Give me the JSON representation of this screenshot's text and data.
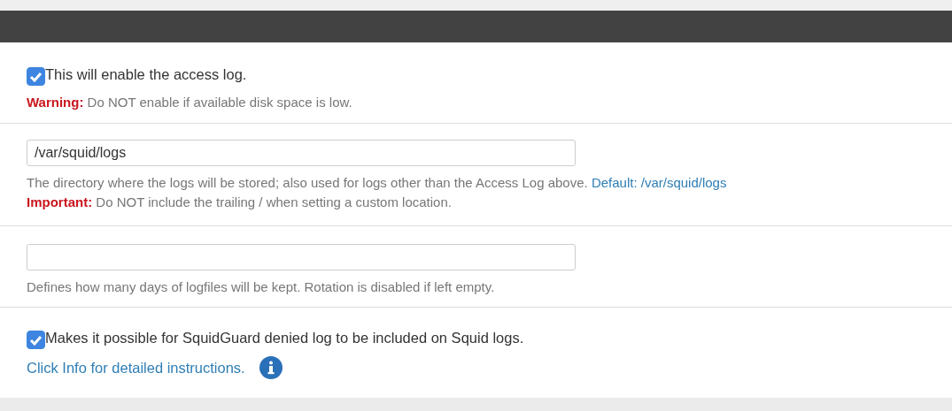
{
  "rows": [
    {
      "kind": "checkbox",
      "checked": true,
      "label": "This will enable the access log.",
      "help": [
        {
          "label": "Warning:",
          "text": "Do NOT enable if available disk space is low."
        }
      ]
    },
    {
      "kind": "input",
      "value": "/var/squid/logs",
      "help": [
        {
          "text": "The directory where the logs will be stored; also used for logs other than the Access Log above.",
          "link": "Default: /var/squid/logs"
        },
        {
          "label": "Important:",
          "text": "Do NOT include the trailing / when setting a custom location."
        }
      ]
    },
    {
      "kind": "input",
      "help": [
        {
          "text": "Defines how many days of logfiles will be kept. Rotation is disabled if left empty."
        }
      ]
    },
    {
      "kind": "checkbox",
      "checked": true,
      "label": "Makes it possible for SquidGuard denied log to be included on Squid logs.",
      "info": "Click Info for detailed instructions."
    }
  ]
}
